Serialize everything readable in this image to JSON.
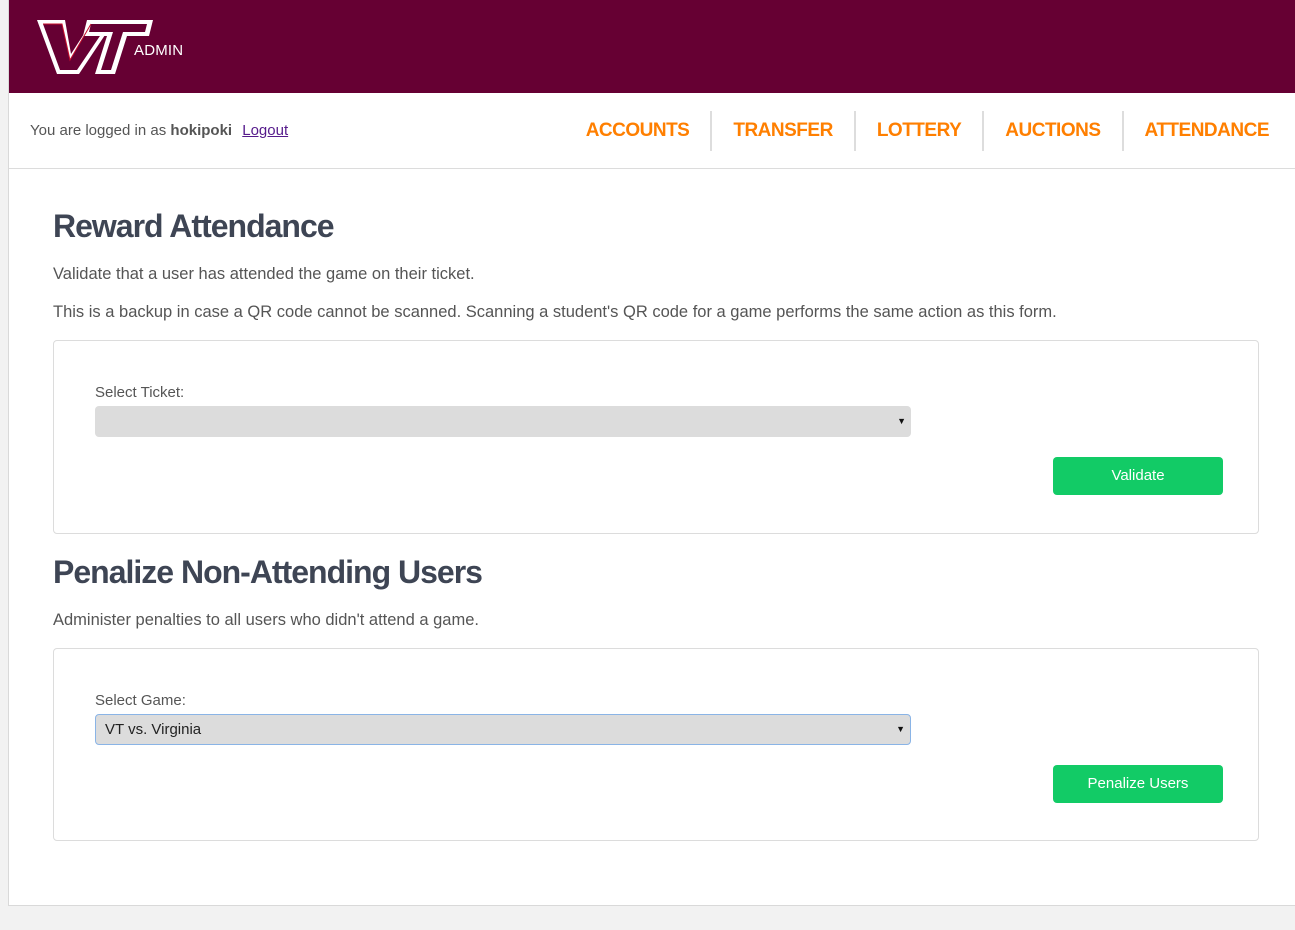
{
  "header": {
    "logo_alt": "VT",
    "admin_label": "ADMIN"
  },
  "session": {
    "prefix": "You are logged in as",
    "username": "hokipoki",
    "logout_label": "Logout"
  },
  "nav": {
    "items": [
      {
        "label": "ACCOUNTS"
      },
      {
        "label": "TRANSFER"
      },
      {
        "label": "LOTTERY"
      },
      {
        "label": "AUCTIONS"
      },
      {
        "label": "ATTENDANCE"
      }
    ]
  },
  "reward": {
    "title": "Reward Attendance",
    "description": "Validate that a user has attended the game on their ticket.",
    "note": "This is a backup in case a QR code cannot be scanned. Scanning a student's QR code for a game performs the same action as this form.",
    "select_label": "Select Ticket:",
    "select_value": "",
    "button_label": "Validate"
  },
  "penalize": {
    "title": "Penalize Non-Attending Users",
    "description": "Administer penalties to all users who didn't attend a game.",
    "select_label": "Select Game:",
    "select_value": "VT vs. Virginia",
    "button_label": "Penalize Users"
  },
  "colors": {
    "brand_maroon": "#660033",
    "nav_orange": "#ff7f00",
    "button_green": "#12cb66"
  }
}
